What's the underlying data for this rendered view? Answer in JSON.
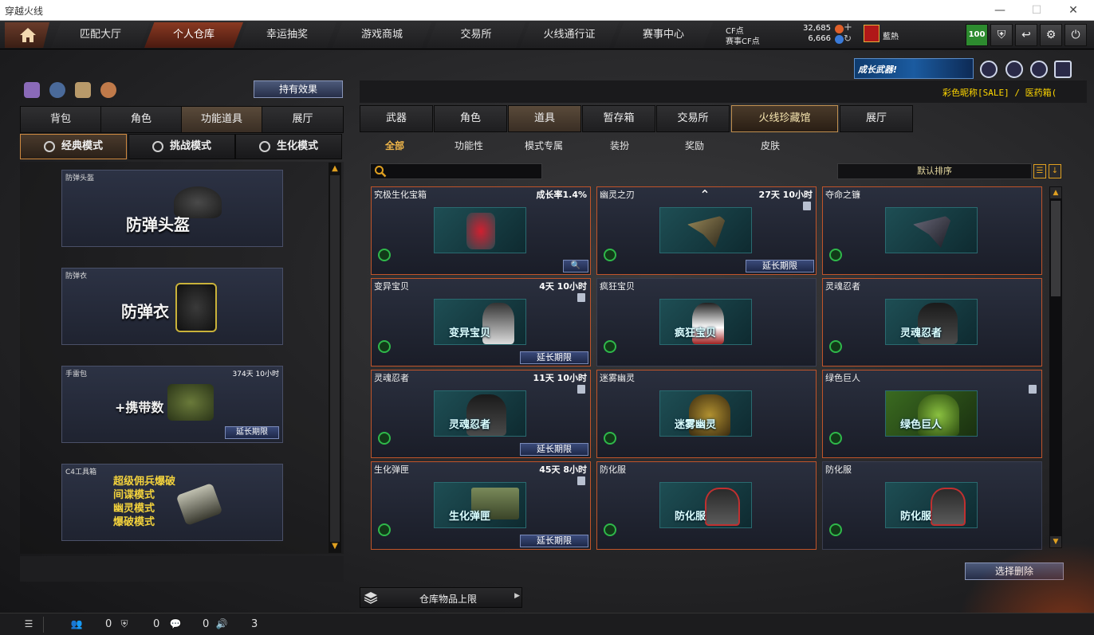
{
  "window": {
    "title": "穿越火线",
    "min": "—",
    "max": "☐",
    "close": "✕"
  },
  "nav": {
    "tabs": [
      "匹配大厅",
      "个人仓库",
      "幸运抽奖",
      "游戏商城",
      "交易所",
      "火线通行证",
      "赛事中心"
    ],
    "active_index": 1
  },
  "currency": {
    "cf_label": "CF点",
    "cf_value": "32,685",
    "event_label": "赛事CF点",
    "event_value": "6,666"
  },
  "player": {
    "rank_name": "藍熱",
    "level": "100"
  },
  "top_buttons": [
    "shield-icon",
    "return-icon",
    "gear-icon",
    "power-icon"
  ],
  "banner": {
    "text": "成长武器!"
  },
  "marquee": "彩色昵称[SALE] / 医药箱(",
  "left": {
    "hold_effect": "持有效果",
    "tabs": [
      "背包",
      "角色",
      "功能道具",
      "展厅"
    ],
    "active_tab": 2,
    "modes": [
      "经典模式",
      "挑战模式",
      "生化模式"
    ],
    "active_mode": 0,
    "cards": [
      {
        "title": "防弹头盔",
        "big": "防弹头盔",
        "time": "",
        "extend": ""
      },
      {
        "title": "防弹衣",
        "big": "防弹衣",
        "time": "",
        "extend": ""
      },
      {
        "title": "手雷包",
        "big": "+携带数",
        "time": "374天 10小时",
        "extend": "延长期限"
      },
      {
        "title": "C4工具箱",
        "lines": [
          "超级佣兵爆破",
          "间谍模式",
          "幽灵模式",
          "爆破模式"
        ],
        "time": "",
        "extend": ""
      }
    ]
  },
  "right": {
    "tabs": [
      "武器",
      "角色",
      "道具",
      "暂存箱",
      "交易所",
      "火线珍藏馆",
      "展厅"
    ],
    "active_tab": 2,
    "subtabs": [
      "全部",
      "功能性",
      "模式专属",
      "装扮",
      "奖励",
      "皮肤"
    ],
    "active_subtab": 0,
    "search_placeholder": "",
    "sort_label": "默认排序",
    "items": [
      {
        "title": "究极生化宝箱",
        "time": "成长率1.4%",
        "art": "",
        "extend": ""
      },
      {
        "title": "幽灵之刃",
        "time": "27天 10小时",
        "art": "",
        "extend": "延长期限"
      },
      {
        "title": "夺命之镰",
        "time": "",
        "art": "",
        "extend": ""
      },
      {
        "title": "变异宝贝",
        "time": "4天 10小时",
        "art": "变异宝贝",
        "extend": "延长期限"
      },
      {
        "title": "疯狂宝贝",
        "time": "",
        "art": "疯狂宝贝",
        "extend": ""
      },
      {
        "title": "灵魂忍者",
        "time": "",
        "art": "灵魂忍者",
        "extend": ""
      },
      {
        "title": "灵魂忍者",
        "time": "11天 10小时",
        "art": "灵魂忍者",
        "extend": "延长期限"
      },
      {
        "title": "迷雾幽灵",
        "time": "",
        "art": "迷雾幽灵",
        "extend": ""
      },
      {
        "title": "绿色巨人",
        "time": "",
        "art": "绿色巨人",
        "extend": ""
      },
      {
        "title": "生化弹匣",
        "time": "45天 8小时",
        "art": "生化弹匣",
        "extend": "延长期限"
      },
      {
        "title": "防化服",
        "time": "",
        "art": "防化服",
        "extend": ""
      },
      {
        "title": "防化服",
        "time": "",
        "art": "防化服",
        "extend": ""
      }
    ],
    "delete_selected": "选择删除",
    "capacity_label": "仓库物品上限"
  },
  "status": {
    "val1": "0",
    "val2": "0",
    "val3": "0",
    "val4": "3"
  }
}
